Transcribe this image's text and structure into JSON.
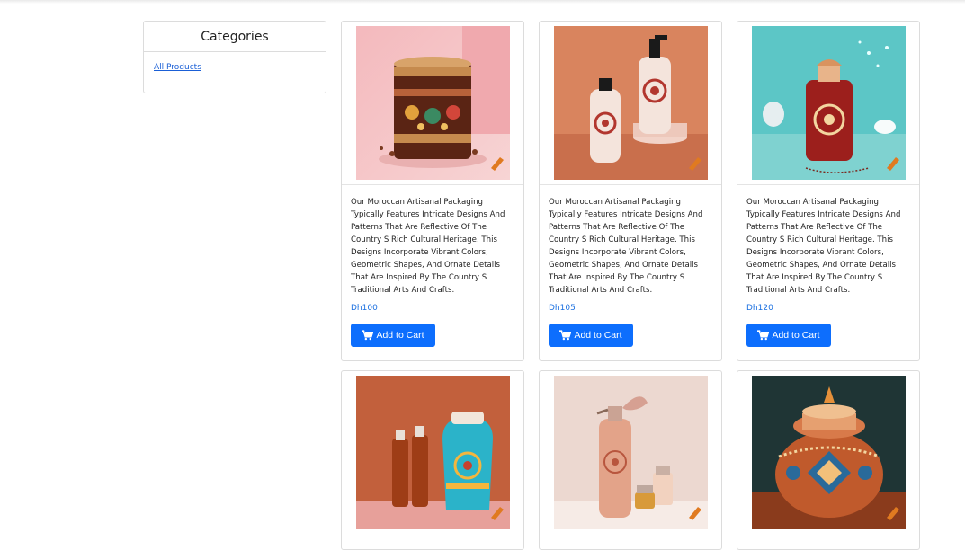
{
  "sidebar": {
    "title": "Categories",
    "links": [
      "All Products"
    ]
  },
  "products": [
    {
      "description": "Our Moroccan Artisanal Packaging Typically Features Intricate Designs And Patterns That Are Reflective Of The Country S Rich Cultural Heritage. This Designs Incorporate Vibrant Colors, Geometric Shapes, And Ornate Details That Are Inspired By The Country S Traditional Arts And Crafts.",
      "price": "Dh100",
      "button_label": "Add to Cart",
      "image": "moroccan-tin-jar"
    },
    {
      "description": "Our Moroccan Artisanal Packaging Typically Features Intricate Designs And Patterns That Are Reflective Of The Country S Rich Cultural Heritage. This Designs Incorporate Vibrant Colors, Geometric Shapes, And Ornate Details That Are Inspired By The Country S Traditional Arts And Crafts.",
      "price": "Dh105",
      "button_label": "Add to Cart",
      "image": "pump-bottles"
    },
    {
      "description": "Our Moroccan Artisanal Packaging Typically Features Intricate Designs And Patterns That Are Reflective Of The Country S Rich Cultural Heritage. This Designs Incorporate Vibrant Colors, Geometric Shapes, And Ornate Details That Are Inspired By The Country S Traditional Arts And Crafts.",
      "price": "Dh120",
      "button_label": "Add to Cart",
      "image": "perfume-bottle"
    },
    {
      "image": "cosmetic-bottles-vase"
    },
    {
      "image": "spray-bottle-set"
    },
    {
      "image": "ornate-ceramic-pot"
    }
  ],
  "colors": {
    "accent": "#0d6efd",
    "price": "#1a6fe0",
    "border": "#dcdcdc"
  }
}
